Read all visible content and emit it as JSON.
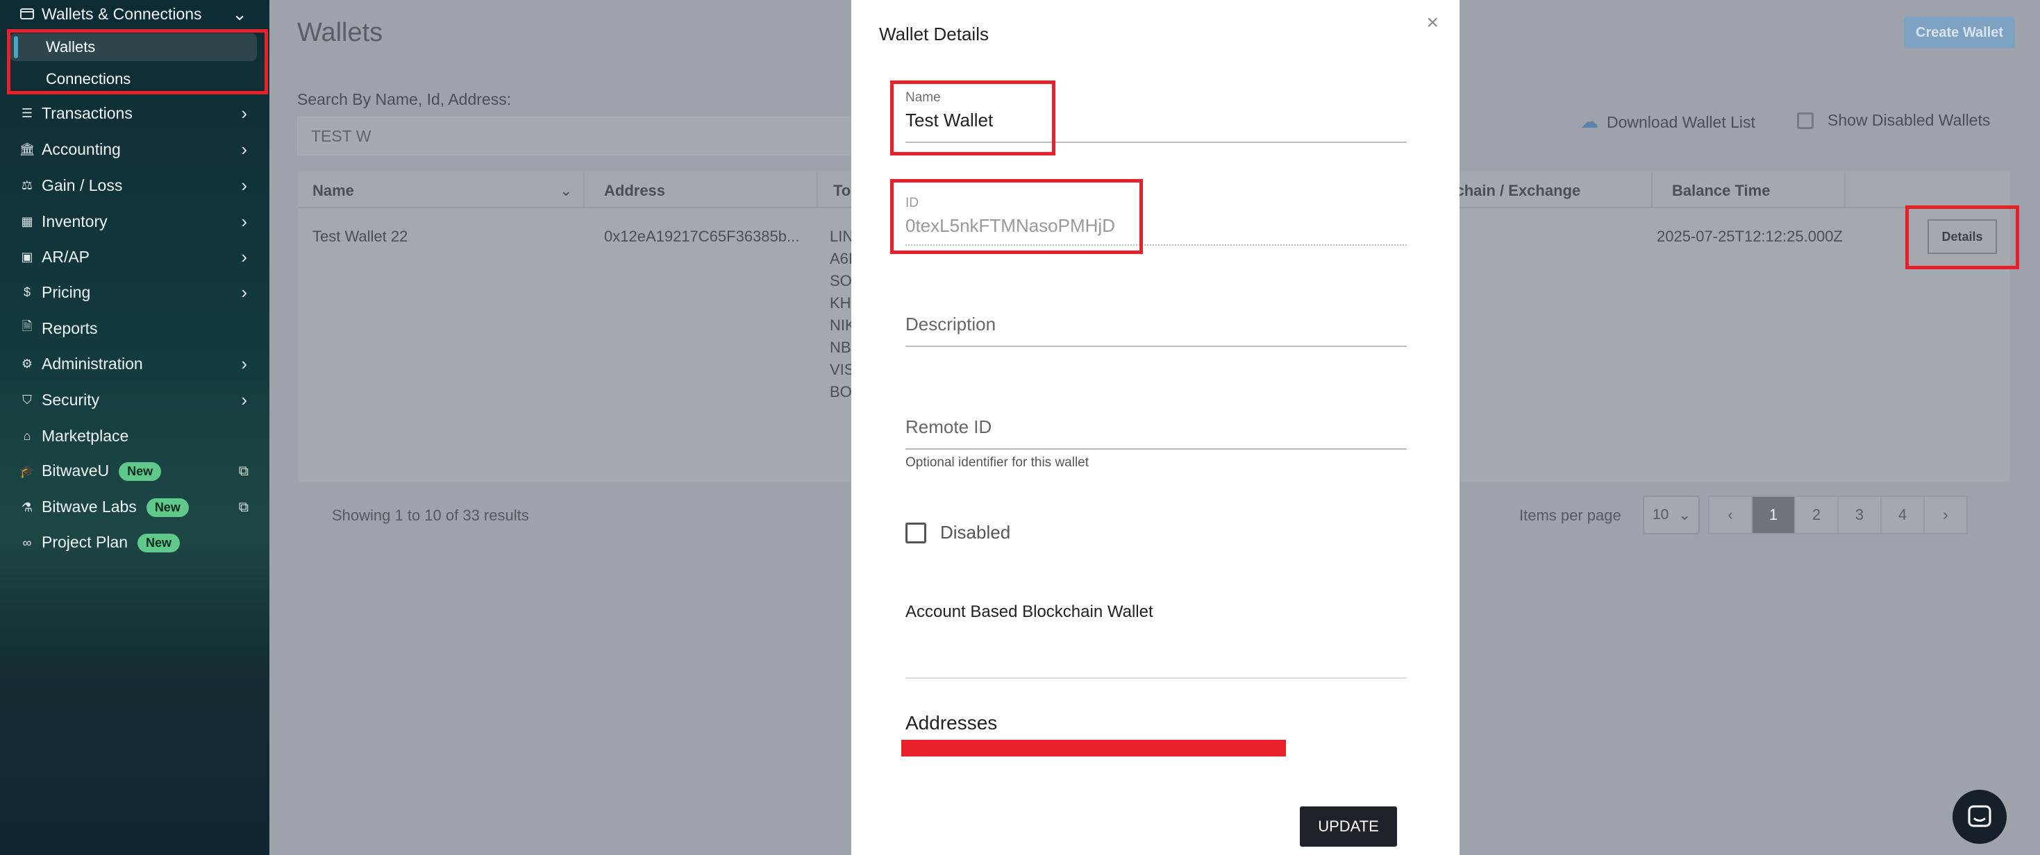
{
  "sidebar": {
    "group_title": "Wallets & Connections",
    "sub_items": [
      {
        "label": "Wallets"
      },
      {
        "label": "Connections"
      }
    ],
    "items": [
      {
        "label": "Transactions",
        "icon": "list-icon"
      },
      {
        "label": "Accounting",
        "icon": "bank-icon"
      },
      {
        "label": "Gain / Loss",
        "icon": "scale-icon"
      },
      {
        "label": "Inventory",
        "icon": "warehouse-icon"
      },
      {
        "label": "AR/AP",
        "icon": "money-icon"
      },
      {
        "label": "Pricing",
        "icon": "dollar-icon"
      },
      {
        "label": "Reports",
        "icon": "document-icon"
      },
      {
        "label": "Administration",
        "icon": "admin-icon"
      },
      {
        "label": "Security",
        "icon": "shield-icon"
      },
      {
        "label": "Marketplace",
        "icon": "tag-icon"
      },
      {
        "label": "BitwaveU",
        "icon": "graduation-icon",
        "badge": "New"
      },
      {
        "label": "Bitwave Labs",
        "icon": "flask-icon",
        "badge": "New"
      },
      {
        "label": "Project Plan",
        "icon": "binoculars-icon",
        "badge": "New"
      }
    ]
  },
  "main": {
    "title": "Wallets",
    "create_button": "Create Wallet",
    "search_label": "Search By Name, Id, Address:",
    "search_value": "TEST W",
    "download_label": "Download Wallet List",
    "show_disabled_label": "Show Disabled Wallets",
    "table": {
      "headers": [
        "Name",
        "Address",
        "To",
        "ckchain / Exchange",
        "Balance Time"
      ],
      "row": {
        "name": "Test Wallet 22",
        "address": "0x12eA19217C65F36385b...",
        "tokens": [
          "LIN",
          "A6I",
          "SO",
          "KH",
          "NIK",
          "NB",
          "VIS",
          "BO"
        ],
        "balance_time": "2025-07-25T12:12:25.000Z",
        "details_button": "Details"
      }
    },
    "showing_text": "Showing 1 to 10 of 33 results",
    "items_per_page_label": "Items per page",
    "items_per_page_value": "10",
    "pages": [
      "1",
      "2",
      "3",
      "4"
    ],
    "current_page": "1"
  },
  "modal": {
    "title": "Wallet Details",
    "name_label": "Name",
    "name_value": "Test Wallet",
    "id_label": "ID",
    "id_value": "0texL5nkFTMNasoPMHjD",
    "description_label": "Description",
    "remote_id_label": "Remote ID",
    "remote_id_hint": "Optional identifier for this wallet",
    "disabled_label": "Disabled",
    "account_based_label": "Account Based Blockchain Wallet",
    "addresses_title": "Addresses",
    "update_button": "UPDATE"
  },
  "colors": {
    "highlight_red": "#e8202a",
    "badge_green": "#5ec98b",
    "sidebar_bg": "#0e2b33"
  }
}
